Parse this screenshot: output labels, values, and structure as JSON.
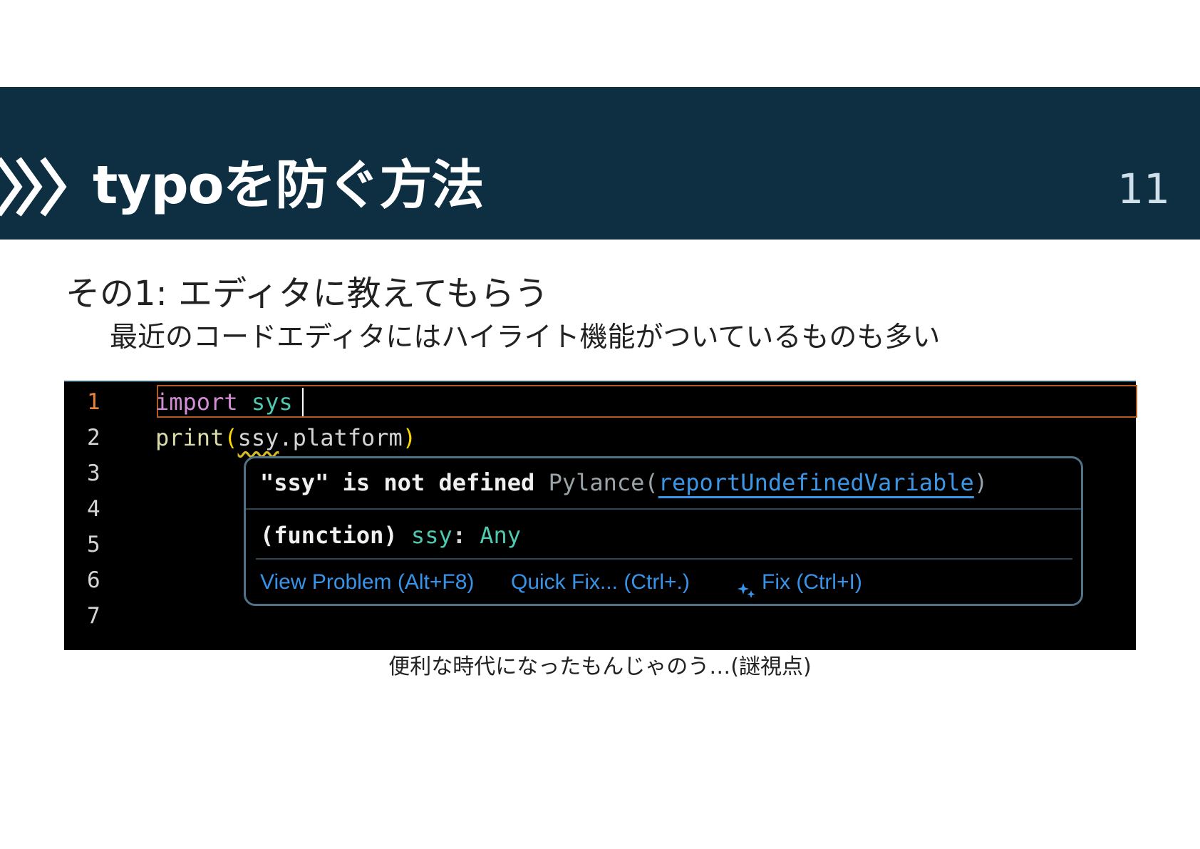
{
  "header": {
    "title": "typoを防ぐ方法",
    "page_number": "11",
    "chevron_icon": "double-chevron-right-icon",
    "band_color": "#0e2e42"
  },
  "content": {
    "subtitle": "その1: エディタに教えてもらう",
    "description": "最近のコードエディタにはハイライト機能がついているものも多い",
    "caption": "便利な時代になったもんじゃのう…(謎視点)"
  },
  "editor": {
    "line_numbers": [
      "1",
      "2",
      "3",
      "4",
      "5",
      "6",
      "7"
    ],
    "line1": {
      "keyword": "import",
      "module": "sys"
    },
    "line2": {
      "func": "print",
      "open_paren": "(",
      "error_name": "ssy",
      "rest": ".platform",
      "close_paren": ")"
    },
    "hover": {
      "message": "\"ssy\" is not defined",
      "source": "Pylance(",
      "rule_link": "reportUndefinedVariable",
      "source_close": ")",
      "signature_prefix": "(function)",
      "signature_name": "ssy",
      "signature_colon": ":",
      "signature_type": "Any",
      "actions": {
        "view_problem": "View Problem (Alt+F8)",
        "quick_fix": "Quick Fix... (Ctrl+.)",
        "fix": "Fix (Ctrl+I)",
        "fix_icon": "sparkle-icon"
      }
    },
    "colors": {
      "keyword": "#d58dd7",
      "module": "#4ec9b0",
      "function": "#dcdcaa",
      "link": "#3794e8",
      "active_line_number": "#e5823c"
    }
  }
}
